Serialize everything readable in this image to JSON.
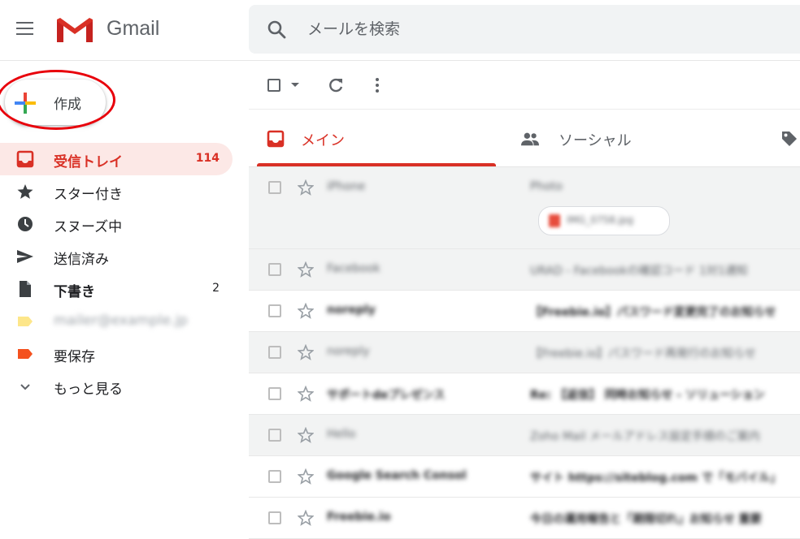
{
  "header": {
    "app_name": "Gmail",
    "search_placeholder": "メールを検索",
    "brand_color": "#d93025"
  },
  "compose": {
    "label": "作成"
  },
  "nav": {
    "items": [
      {
        "label": "受信トレイ",
        "count": "114",
        "icon": "inbox-icon",
        "active": true
      },
      {
        "label": "スター付き",
        "count": "",
        "icon": "star-icon"
      },
      {
        "label": "スヌーズ中",
        "count": "",
        "icon": "clock-icon"
      },
      {
        "label": "送信済み",
        "count": "",
        "icon": "send-icon"
      },
      {
        "label": "下書き",
        "count": "2",
        "icon": "draft-icon",
        "bold": true
      },
      {
        "label": "mailer@example.jp",
        "count": "",
        "icon": "label-icon-yellow",
        "blurred": true
      },
      {
        "label": "要保存",
        "count": "",
        "icon": "label-icon-red"
      },
      {
        "label": "もっと見る",
        "count": "",
        "icon": "chevron-down-icon"
      }
    ]
  },
  "tabs": [
    {
      "label": "メイン",
      "icon": "inbox-icon",
      "selected": true
    },
    {
      "label": "ソーシャル",
      "icon": "people-icon"
    },
    {
      "label": "",
      "icon": "tag-icon"
    }
  ],
  "emails": [
    {
      "sender": "iPhone",
      "subject": "Photo",
      "attachment": "IMG_0758.jpg",
      "unread": false
    },
    {
      "sender": "Facebook",
      "subject": "URAD - Facebookの確認コード 1対1通知",
      "unread": false
    },
    {
      "sender": "noreply",
      "subject": "【Freebie.io】パスワード変更完了のお知らせ",
      "unread": true
    },
    {
      "sender": "noreply",
      "subject": "【Freebie.io】パスワード再発行のお知らせ",
      "unread": false
    },
    {
      "sender": "サポートdeプレゼンス",
      "subject": "Re: 【返信】 同時お知らせ - ソリューション",
      "unread": true
    },
    {
      "sender": "Hello",
      "subject": "Zoho Mail メールアドレス設定手順のご案内",
      "unread": false
    },
    {
      "sender": "Google Search Consol",
      "subject": "サイト https://siteblog.com で「モバイル」",
      "unread": true
    },
    {
      "sender": "Freebie.io",
      "subject": "今日の運用報告と「期限切れ」お知らせ 重要",
      "unread": true
    }
  ]
}
